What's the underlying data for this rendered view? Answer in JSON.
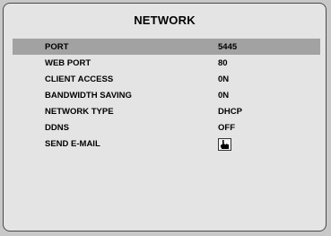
{
  "title": "NETWORK",
  "settings": [
    {
      "label": "PORT",
      "value": "5445",
      "selected": true
    },
    {
      "label": "WEB PORT",
      "value": "80"
    },
    {
      "label": "CLIENT ACCESS",
      "value": "0N"
    },
    {
      "label": "BANDWIDTH SAVING",
      "value": "0N"
    },
    {
      "label": "NETWORK TYPE",
      "value": "DHCP"
    },
    {
      "label": "DDNS",
      "value": "OFF"
    },
    {
      "label": "SEND E-MAIL",
      "icon": "hand-pointer-icon"
    }
  ],
  "colors": {
    "background": "#e4e4e4",
    "selected_row": "#a2a2a2",
    "border": "#4a4a4a"
  }
}
